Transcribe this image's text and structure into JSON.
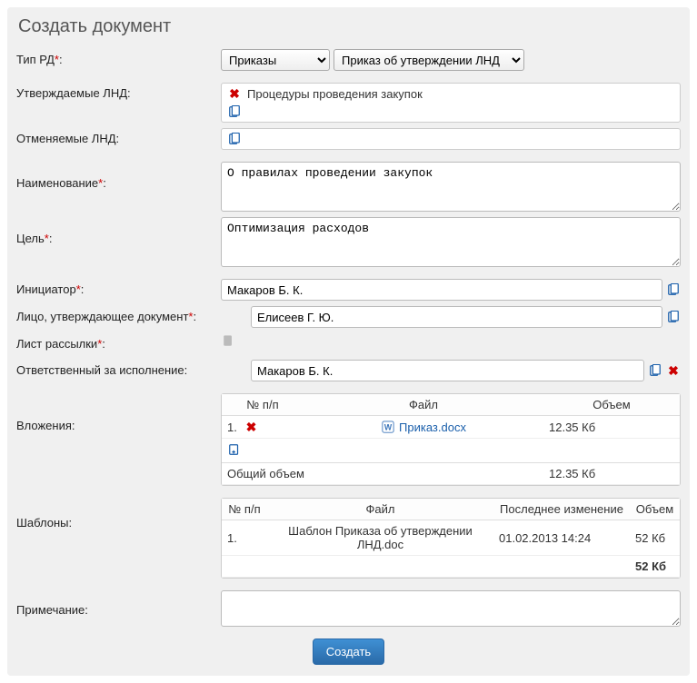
{
  "title": "Создать документ",
  "labels": {
    "type_rd": "Тип РД",
    "approved_lnd": "Утверждаемые ЛНД:",
    "cancelled_lnd": "Отменяемые ЛНД:",
    "name": "Наименование",
    "goal": "Цель",
    "initiator": "Инициатор",
    "approver": "Лицо, утверждающее документ",
    "distribution": "Лист рассылки",
    "responsible": "Ответственный за исполнение:",
    "attachments": "Вложения:",
    "templates": "Шаблоны:",
    "note": "Примечание:"
  },
  "type_rd": {
    "select1": "Приказы",
    "select2": "Приказ об утверждении ЛНД"
  },
  "approved_lnd_item": "Процедуры проведения закупок",
  "name_value": "О правилах проведении закупок",
  "goal_value": "Оптимизация расходов",
  "initiator_value": "Макаров Б. К.",
  "approver_value": "Елисеев Г. Ю.",
  "responsible_value": "Макаров Б. К.",
  "attachments_table": {
    "headers": {
      "num": "№ п/п",
      "file": "Файл",
      "size": "Объем"
    },
    "row": {
      "num": "1.",
      "file": "Приказ.docx",
      "size": "12.35 Кб"
    },
    "total_label": "Общий объем",
    "total_size": "12.35 Кб"
  },
  "templates_table": {
    "headers": {
      "num": "№ п/п",
      "file": "Файл",
      "modified": "Последнее изменение",
      "size": "Объем"
    },
    "row": {
      "num": "1.",
      "file": "Шаблон Приказа об утверждении ЛНД.doc",
      "modified": "01.02.2013 14:24",
      "size": "52 Кб"
    },
    "total_size": "52 Кб"
  },
  "buttons": {
    "create": "Создать"
  },
  "colon": ":",
  "asterisk": "*"
}
